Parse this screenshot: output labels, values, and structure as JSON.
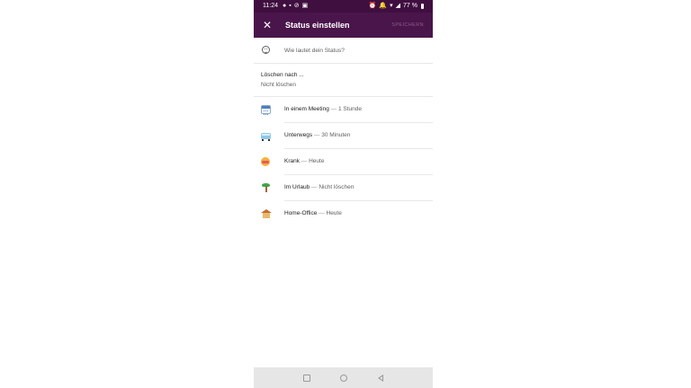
{
  "status_bar": {
    "time": "11:24",
    "left_icons": [
      "●",
      "▪",
      "⊘",
      "▣"
    ],
    "right_icons": [
      "⏰",
      "🔔",
      "▾",
      "◢"
    ],
    "battery": "77 %"
  },
  "header": {
    "title": "Status einstellen",
    "save_label": "SPEICHERN",
    "close_icon": "close-icon"
  },
  "status_input": {
    "placeholder": "Wie lautet dein Status?",
    "value": ""
  },
  "clear_after": {
    "label": "Löschen nach ...",
    "value": "Nicht löschen"
  },
  "presets": [
    {
      "label": "In einem Meeting",
      "sep": " — ",
      "duration": "1 Stunde",
      "icon": "calendar-icon"
    },
    {
      "label": "Unterwegs",
      "sep": " — ",
      "duration": "30 Minuten",
      "icon": "bus-icon"
    },
    {
      "label": "Krank",
      "sep": " — ",
      "duration": "Heute",
      "icon": "sick-face-icon"
    },
    {
      "label": "Im Urlaub",
      "sep": " — ",
      "duration": "Nicht löschen",
      "icon": "palm-tree-icon"
    },
    {
      "label": "Home-Office",
      "sep": " — ",
      "duration": "Heute",
      "icon": "house-icon"
    }
  ],
  "colors": {
    "appbar": "#4a154b",
    "statusbar": "#3f0f3f",
    "navbar": "#e6e6e6"
  }
}
